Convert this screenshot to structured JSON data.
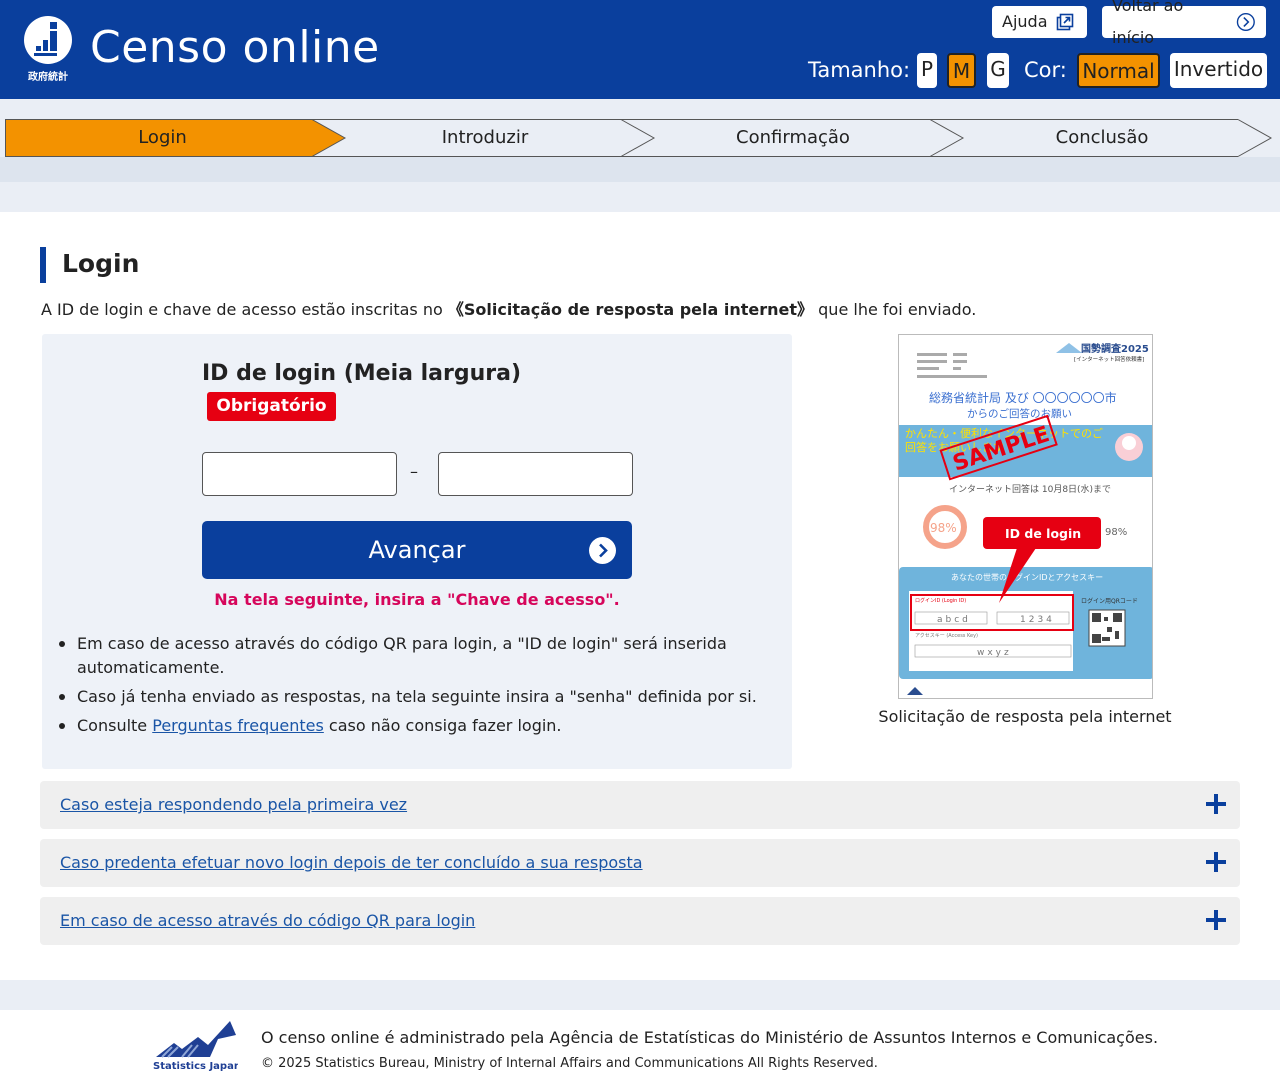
{
  "header": {
    "logo_text": "政府統計",
    "title": "Censo online",
    "help_label": "Ajuda",
    "home_label": "Voltar ao início",
    "size_label": "Tamanho:",
    "sizes": [
      "P",
      "M",
      "G"
    ],
    "size_selected": "M",
    "color_label": "Cor:",
    "color_options": [
      "Normal",
      "Invertido"
    ],
    "color_selected": "Normal"
  },
  "steps": [
    "Login",
    "Introduzir",
    "Confirmação",
    "Conclusão"
  ],
  "current_step": "Login",
  "login": {
    "title": "Login",
    "intro_before": "A ID de login e chave de acesso estão inscritas no",
    "intro_doc": "《Solicitação de resposta pela internet》",
    "intro_after": "que lhe foi enviado.",
    "id_label": "ID de login (Meia largura)",
    "required": "Obrigatório",
    "field_1_value": "",
    "field_2_value": "",
    "separator": "–",
    "next_label": "Avançar",
    "hint": "Na tela seguinte, insira a \"Chave de acesso\".",
    "notes": [
      "Em caso de acesso através do código QR para login, a \"ID de login\" será inserida automaticamente.",
      "Caso já tenha enviado as respostas, na tela seguinte insira a \"senha\" definida por si."
    ],
    "note3_before": "Consulte",
    "note3_link": "Perguntas frequentes",
    "note3_after": "caso não consiga fazer login."
  },
  "sample": {
    "title": "国勢調査2025",
    "subtitle": "[インターネット回答依頼書]",
    "line1": "総務省統計局 及び 〇〇〇〇〇〇市",
    "line2": "からのご回答のお願い",
    "banner": "かんたん・便利なインターネットでのご回答をお願いします",
    "deadline": "インターネット回答は 10月8日(水)まで",
    "percent_left": "98%",
    "percent_right": "98%",
    "box_title": "あなたの世帯のログインIDとアクセスキー",
    "login_id_label": "ログインID (Login ID)",
    "login_id_value": "abcd",
    "login_id_value2": "1234",
    "access_key_label": "アクセスキー (Access Key)",
    "access_key_value": "wxyz",
    "qr_label": "ログイン用QRコード",
    "stamp": "SAMPLE",
    "callout": "ID de login",
    "caption": "Solicitação de resposta pela internet"
  },
  "accordion": [
    "Caso esteja respondendo pela primeira vez",
    "Caso predenta efetuar novo login depois de ter concluído a sua resposta",
    "Em caso de acesso através do código QR para login"
  ],
  "footer": {
    "logo_text": "Statistics Japan",
    "text": "O censo online é administrado pela Agência de Estatísticas do Ministério de Assuntos Internos e Comunicações.",
    "copyright": "© 2025 Statistics Bureau, Ministry of Internal Affairs and Communications All Rights Reserved."
  },
  "colors": {
    "brand_blue": "#0a3f9d",
    "active_orange": "#f39200",
    "required_red": "#e60012",
    "hint_pink": "#d6065b",
    "link_blue": "#1a55a6"
  }
}
